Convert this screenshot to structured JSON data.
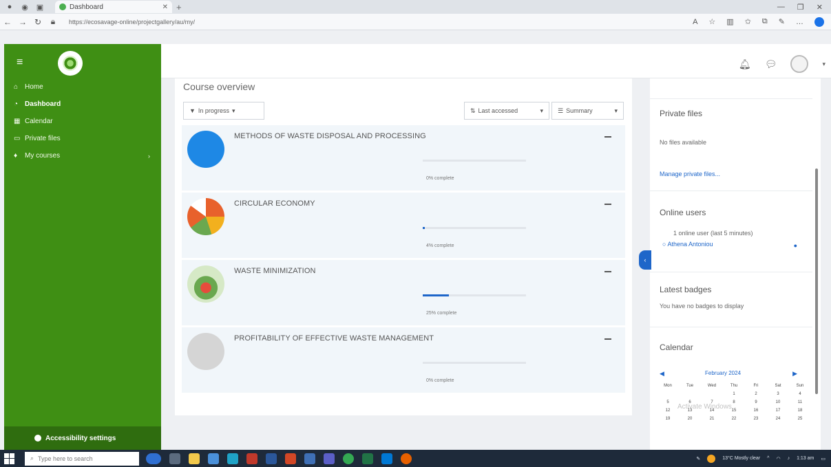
{
  "browser": {
    "tab_title": "Dashboard",
    "url": "https://ecosavage-online/projectgallery/au/my/"
  },
  "sidebar": {
    "items": [
      {
        "label": "Home",
        "icon": "home-icon"
      },
      {
        "label": "Dashboard",
        "icon": "dashboard-icon"
      },
      {
        "label": "Calendar",
        "icon": "calendar-icon"
      },
      {
        "label": "Private files",
        "icon": "file-icon"
      },
      {
        "label": "My courses",
        "icon": "graduation-icon"
      }
    ],
    "accessibility_label": "Accessibility settings"
  },
  "main": {
    "section_title": "Course overview",
    "filter_label": "In progress",
    "sort_label": "Last accessed",
    "view_label": "Summary",
    "courses": [
      {
        "title": "METHODS OF WASTE DISPOSAL AND PROCESSING",
        "progress": 0,
        "progress_label": "0% complete",
        "image_color": "#1e88e5"
      },
      {
        "title": "CIRCULAR ECONOMY",
        "progress": 4,
        "progress_label": "4% complete",
        "image_color": "#e8612c"
      },
      {
        "title": "WASTE MINIMIZATION",
        "progress": 25,
        "progress_label": "25% complete",
        "image_color": "#6aa84f"
      },
      {
        "title": "PROFITABILITY OF EFFECTIVE WASTE MANAGEMENT",
        "progress": 0,
        "progress_label": "0% complete",
        "image_color": "#cfcfcf"
      }
    ]
  },
  "blocks": {
    "private_files": {
      "title": "Private files",
      "empty_text": "No files available",
      "link": "Manage private files..."
    },
    "online_users": {
      "title": "Online users",
      "summary": "1 online user (last 5 minutes)",
      "user": "Athena Antoniou"
    },
    "latest_badges": {
      "title": "Latest badges",
      "empty_text": "You have no badges to display"
    },
    "calendar": {
      "title": "Calendar",
      "month": "February 2024",
      "day_headers": [
        "Mon",
        "Tue",
        "Wed",
        "Thu",
        "Fri",
        "Sat",
        "Sun"
      ],
      "week1": [
        "",
        "",
        "",
        "1",
        "2",
        "3",
        "4"
      ],
      "week2": [
        "5",
        "6",
        "7",
        "8",
        "9",
        "10",
        "11"
      ],
      "week3": [
        "12",
        "13",
        "14",
        "15",
        "16",
        "17",
        "18"
      ],
      "week4": [
        "19",
        "20",
        "21",
        "22",
        "23",
        "24",
        "25"
      ]
    },
    "watermark": "Activate Windows"
  },
  "taskbar": {
    "search_placeholder": "Type here to search",
    "weather": "13°C Mostly clear",
    "time": "1:13 am"
  }
}
